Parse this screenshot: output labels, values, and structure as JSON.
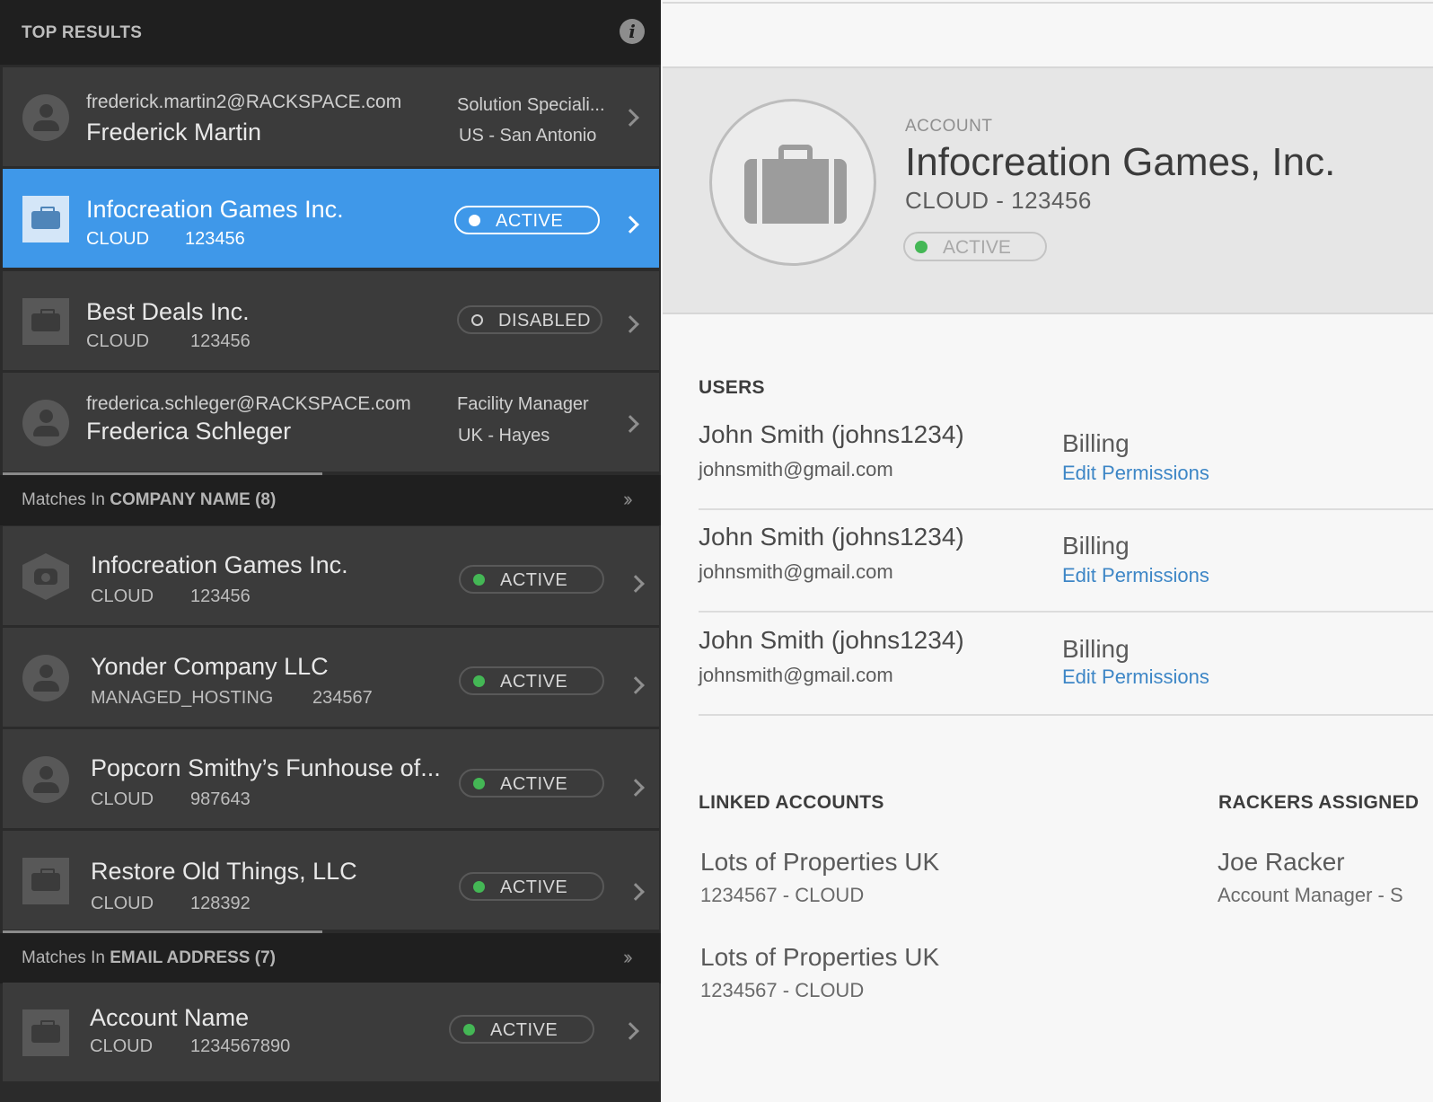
{
  "left": {
    "header_title": "TOP RESULTS",
    "top_results": [
      {
        "kind": "user",
        "email": "frederick.martin2@RACKSPACE.com",
        "name": "Frederick Martin",
        "role": "Solution Speciali...",
        "location": "US - San Antonio"
      },
      {
        "kind": "account",
        "name": "Infocreation Games Inc.",
        "type": "CLOUD",
        "number": "123456",
        "status": "ACTIVE"
      },
      {
        "kind": "account",
        "name": "Best Deals Inc.",
        "type": "CLOUD",
        "number": "123456",
        "status": "DISABLED"
      },
      {
        "kind": "user",
        "email": "frederica.schleger@RACKSPACE.com",
        "name": "Frederica Schleger",
        "role": "Facility Manager",
        "location": "UK - Hayes"
      }
    ],
    "company_section": {
      "prefix": "Matches In ",
      "field": "COMPANY NAME",
      "count": "(8)"
    },
    "company_results": [
      {
        "name": "Infocreation Games Inc.",
        "type": "CLOUD",
        "number": "123456",
        "status": "ACTIVE"
      },
      {
        "name": "Yonder Company LLC",
        "type": "MANAGED_HOSTING",
        "number": "234567",
        "status": "ACTIVE"
      },
      {
        "name": "Popcorn Smithy’s Funhouse of...",
        "type": "CLOUD",
        "number": "987643",
        "status": "ACTIVE"
      },
      {
        "name": "Restore Old Things, LLC",
        "type": "CLOUD",
        "number": "128392",
        "status": "ACTIVE"
      }
    ],
    "email_section": {
      "prefix": "Matches In ",
      "field": "EMAIL ADDRESS",
      "count": "(7)"
    },
    "email_results": [
      {
        "name": "Account Name",
        "type": "CLOUD",
        "number": "1234567890",
        "status": "ACTIVE"
      }
    ]
  },
  "account": {
    "label": "ACCOUNT",
    "name": "Infocreation Games, Inc.",
    "type_line": "CLOUD - 123456",
    "status": "ACTIVE"
  },
  "users_heading": "USERS",
  "users": [
    {
      "name": "John Smith (johns1234)",
      "email": "johnsmith@gmail.com",
      "role": "Billing",
      "action": "Edit Permissions"
    },
    {
      "name": "John Smith (johns1234)",
      "email": "johnsmith@gmail.com",
      "role": "Billing",
      "action": "Edit Permissions"
    },
    {
      "name": "John Smith (johns1234)",
      "email": "johnsmith@gmail.com",
      "role": "Billing",
      "action": "Edit Permissions"
    }
  ],
  "linked_heading": "LINKED ACCOUNTS",
  "linked_accounts": [
    {
      "name": "Lots of Properties UK",
      "sub": "1234567 - CLOUD"
    },
    {
      "name": "Lots of Properties UK",
      "sub": "1234567 - CLOUD"
    }
  ],
  "rackers_heading": "RACKERS ASSIGNED",
  "rackers": [
    {
      "name": "Joe Racker",
      "role": "Account Manager - S"
    }
  ],
  "colors": {
    "accent": "#3f98e9",
    "active_dot": "#44b755",
    "link": "#3d86c6"
  }
}
